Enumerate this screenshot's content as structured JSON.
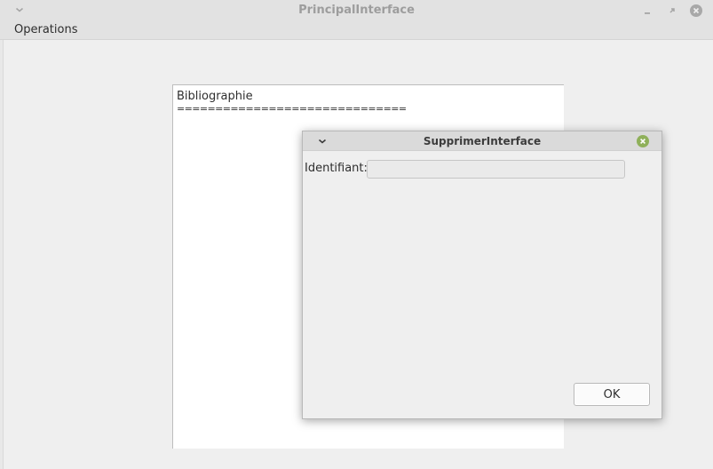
{
  "main_window": {
    "title": "PrincipalInterface",
    "menu": [
      {
        "label": "Operations"
      }
    ],
    "text_area": {
      "heading": "Bibliographie",
      "rule": "=============================="
    }
  },
  "dialog": {
    "title": "SupprimerInterface",
    "field_label": "Identifiant:",
    "field_value": "",
    "ok_label": "OK"
  },
  "colors": {
    "dialog_close": "#8fb05a",
    "window_buttons": "#9d9d9d"
  },
  "icons": [
    "chevron-down-icon",
    "minimize-icon",
    "maximize-icon",
    "close-icon",
    "dialog-close-icon"
  ]
}
